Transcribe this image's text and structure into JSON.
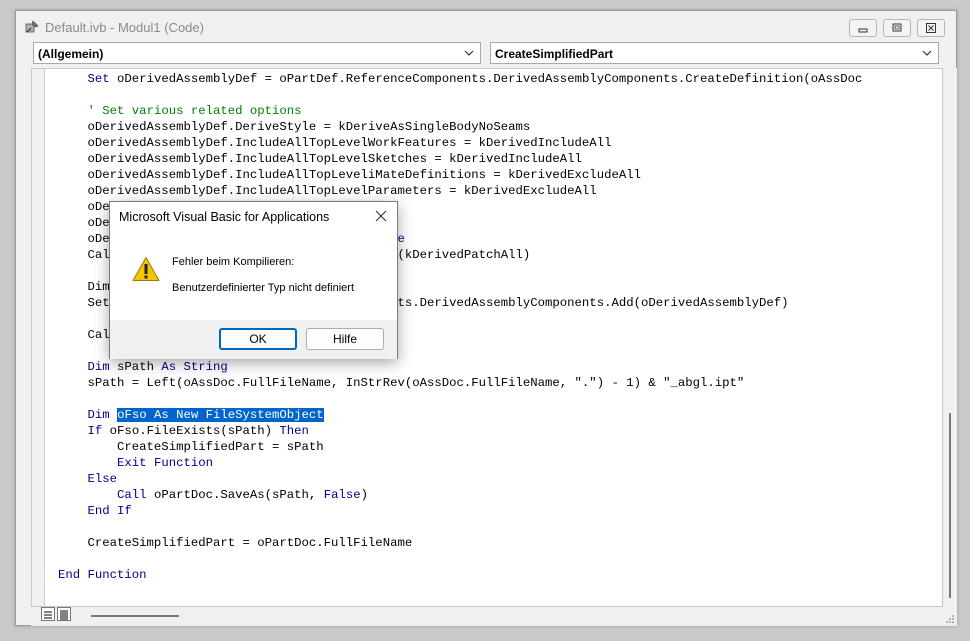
{
  "window": {
    "title": "Default.ivb - Modul1 (Code)"
  },
  "dropdowns": {
    "object": "(Allgemein)",
    "procedure": "CreateSimplifiedPart"
  },
  "code_lines": [
    [
      {
        "t": "    "
      },
      {
        "t": "Set",
        "c": "kw"
      },
      {
        "t": " oDerivedAssemblyDef = oPartDef.ReferenceComponents.DerivedAssemblyComponents.CreateDefinition(oAssDoc"
      }
    ],
    [
      {
        "t": ""
      }
    ],
    [
      {
        "t": "    "
      },
      {
        "t": "' Set various related options",
        "c": "cm"
      }
    ],
    [
      {
        "t": "    oDerivedAssemblyDef.DeriveStyle = kDeriveAsSingleBodyNoSeams"
      }
    ],
    [
      {
        "t": "    oDerivedAssemblyDef.IncludeAllTopLevelWorkFeatures = kDerivedIncludeAll"
      }
    ],
    [
      {
        "t": "    oDerivedAssemblyDef.IncludeAllTopLevelSketches = kDerivedIncludeAll"
      }
    ],
    [
      {
        "t": "    oDerivedAssemblyDef.IncludeAllTopLeveliMateDefinitions = kDerivedExcludeAll"
      }
    ],
    [
      {
        "t": "    oDerivedAssemblyDef.IncludeAllTopLevelParameters = kDerivedExcludeAll"
      }
    ],
    [
      {
        "t": "    oDe                             = "
      },
      {
        "t": "True",
        "c": "kw"
      }
    ],
    [
      {
        "t": "    oDe                               = "
      },
      {
        "t": "True",
        "c": "kw"
      }
    ],
    [
      {
        "t": "    oDe                            ource = "
      },
      {
        "t": "True",
        "c": "kw"
      }
    ],
    [
      {
        "t": "    Cal                             ingOptions(kDerivedPatchAll)"
      }
    ],
    [
      {
        "t": ""
      }
    ],
    [
      {
        "t": "    Dim                            yComponent"
      }
    ],
    [
      {
        "t": "    Set                            aceComponents.DerivedAssemblyComponents.Add(oDerivedAssemblyDef)"
      }
    ],
    [
      {
        "t": ""
      }
    ],
    [
      {
        "t": "    Cal"
      }
    ],
    [
      {
        "t": ""
      }
    ],
    [
      {
        "t": "    "
      },
      {
        "t": "Dim",
        "c": "kw"
      },
      {
        "t": " sPath "
      },
      {
        "t": "As",
        "c": "kw"
      },
      {
        "t": " "
      },
      {
        "t": "String",
        "c": "kw"
      }
    ],
    [
      {
        "t": "    sPath = Left(oAssDoc.FullFileName, InStrRev(oAssDoc.FullFileName, \".\") - 1) & \"_abgl.ipt\""
      }
    ],
    [
      {
        "t": ""
      }
    ],
    [
      {
        "t": "    "
      },
      {
        "t": "Dim",
        "c": "kw"
      },
      {
        "t": " "
      },
      {
        "t": "oFso As New FileSystemObject",
        "c": "sel"
      }
    ],
    [
      {
        "t": "    "
      },
      {
        "t": "If",
        "c": "kw"
      },
      {
        "t": " oFso.FileExists(sPath) "
      },
      {
        "t": "Then",
        "c": "kw"
      }
    ],
    [
      {
        "t": "        CreateSimplifiedPart = sPath"
      }
    ],
    [
      {
        "t": "        "
      },
      {
        "t": "Exit Function",
        "c": "kw"
      }
    ],
    [
      {
        "t": "    "
      },
      {
        "t": "Else",
        "c": "kw"
      }
    ],
    [
      {
        "t": "        "
      },
      {
        "t": "Call",
        "c": "kw"
      },
      {
        "t": " oPartDoc.SaveAs(sPath, "
      },
      {
        "t": "False",
        "c": "kw"
      },
      {
        "t": ")"
      }
    ],
    [
      {
        "t": "    "
      },
      {
        "t": "End If",
        "c": "kw"
      }
    ],
    [
      {
        "t": ""
      }
    ],
    [
      {
        "t": "    CreateSimplifiedPart = oPartDoc.FullFileName"
      }
    ],
    [
      {
        "t": ""
      }
    ],
    [
      {
        "t": "End Function",
        "c": "kw"
      }
    ]
  ],
  "dialog": {
    "title": "Microsoft Visual Basic for Applications",
    "message_line1": "Fehler beim Kompilieren:",
    "message_line2": "Benutzerdefinierter Typ nicht definiert",
    "ok_label": "OK",
    "help_label": "Hilfe",
    "icon": "warning-icon"
  },
  "colors": {
    "keyword": "#00008b",
    "comment": "#008000",
    "selection": "#0066cc"
  }
}
